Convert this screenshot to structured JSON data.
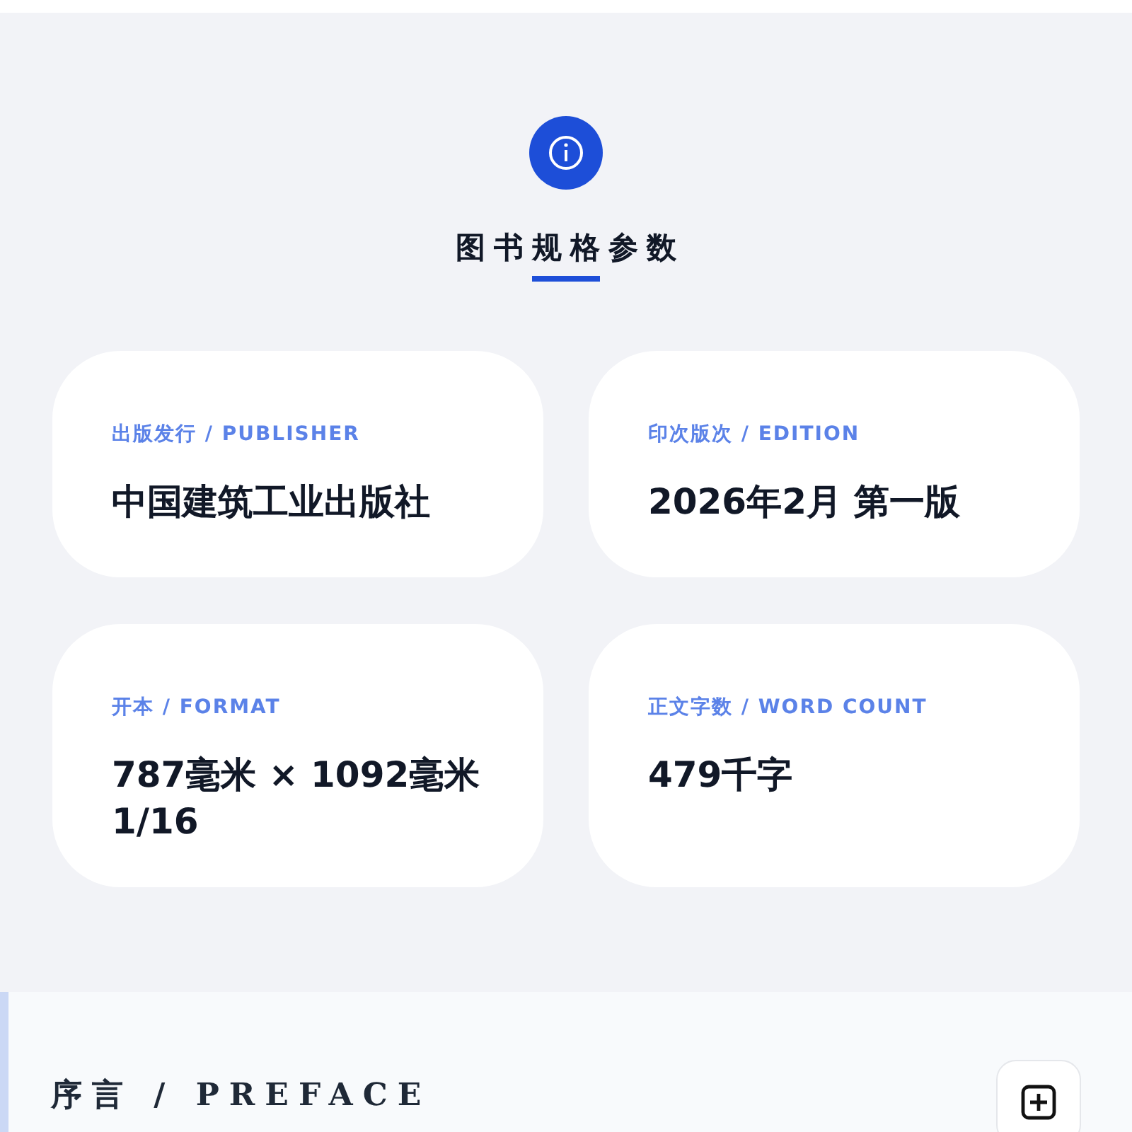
{
  "specs": {
    "title": "图书规格参数",
    "cards": [
      {
        "label": "出版发行 / PUBLISHER",
        "value": "中国建筑工业出版社"
      },
      {
        "label": "印次版次 / EDITION",
        "value": "2026年2月 第一版"
      },
      {
        "label": "开本 / FORMAT",
        "value": "787毫米 × 1092毫米 1/16"
      },
      {
        "label": "正文字数 / WORD COUNT",
        "value": "479千字"
      }
    ]
  },
  "preface": {
    "title": "序言 / PREFACE"
  }
}
